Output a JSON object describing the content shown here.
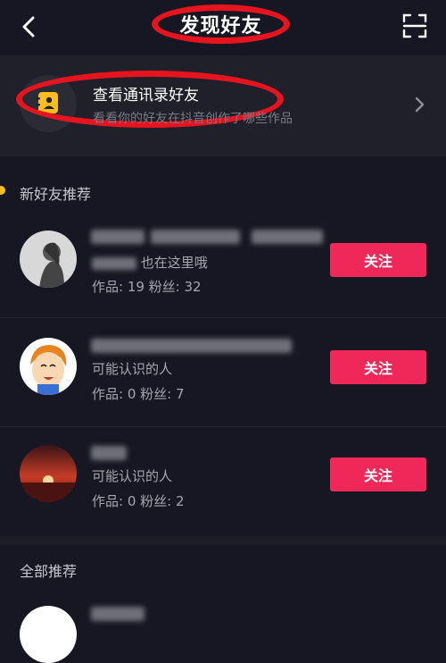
{
  "header": {
    "title": "发现好友",
    "back_icon": "chevron-left-icon",
    "scan_icon": "scan-icon"
  },
  "contacts": {
    "title": "查看通讯录好友",
    "subtitle": "看看你的好友在抖音创作了哪些作品",
    "icon": "contact-card-icon",
    "chevron_icon": "chevron-right-icon"
  },
  "section_new": {
    "title": "新好友推荐"
  },
  "friends": [
    {
      "desc_suffix": "也在这里哦",
      "stats": "作品: 19  粉丝: 32",
      "follow_label": "关注"
    },
    {
      "desc": "可能认识的人",
      "stats": "作品: 0  粉丝: 7",
      "follow_label": "关注"
    },
    {
      "desc": "可能认识的人",
      "stats": "作品: 0  粉丝: 2",
      "follow_label": "关注"
    }
  ],
  "section_all": {
    "title": "全部推荐"
  },
  "colors": {
    "background": "#161722",
    "accent_follow": "#f0285a",
    "annotation_red": "#e5141f",
    "section_dot": "#fdbd1d"
  }
}
